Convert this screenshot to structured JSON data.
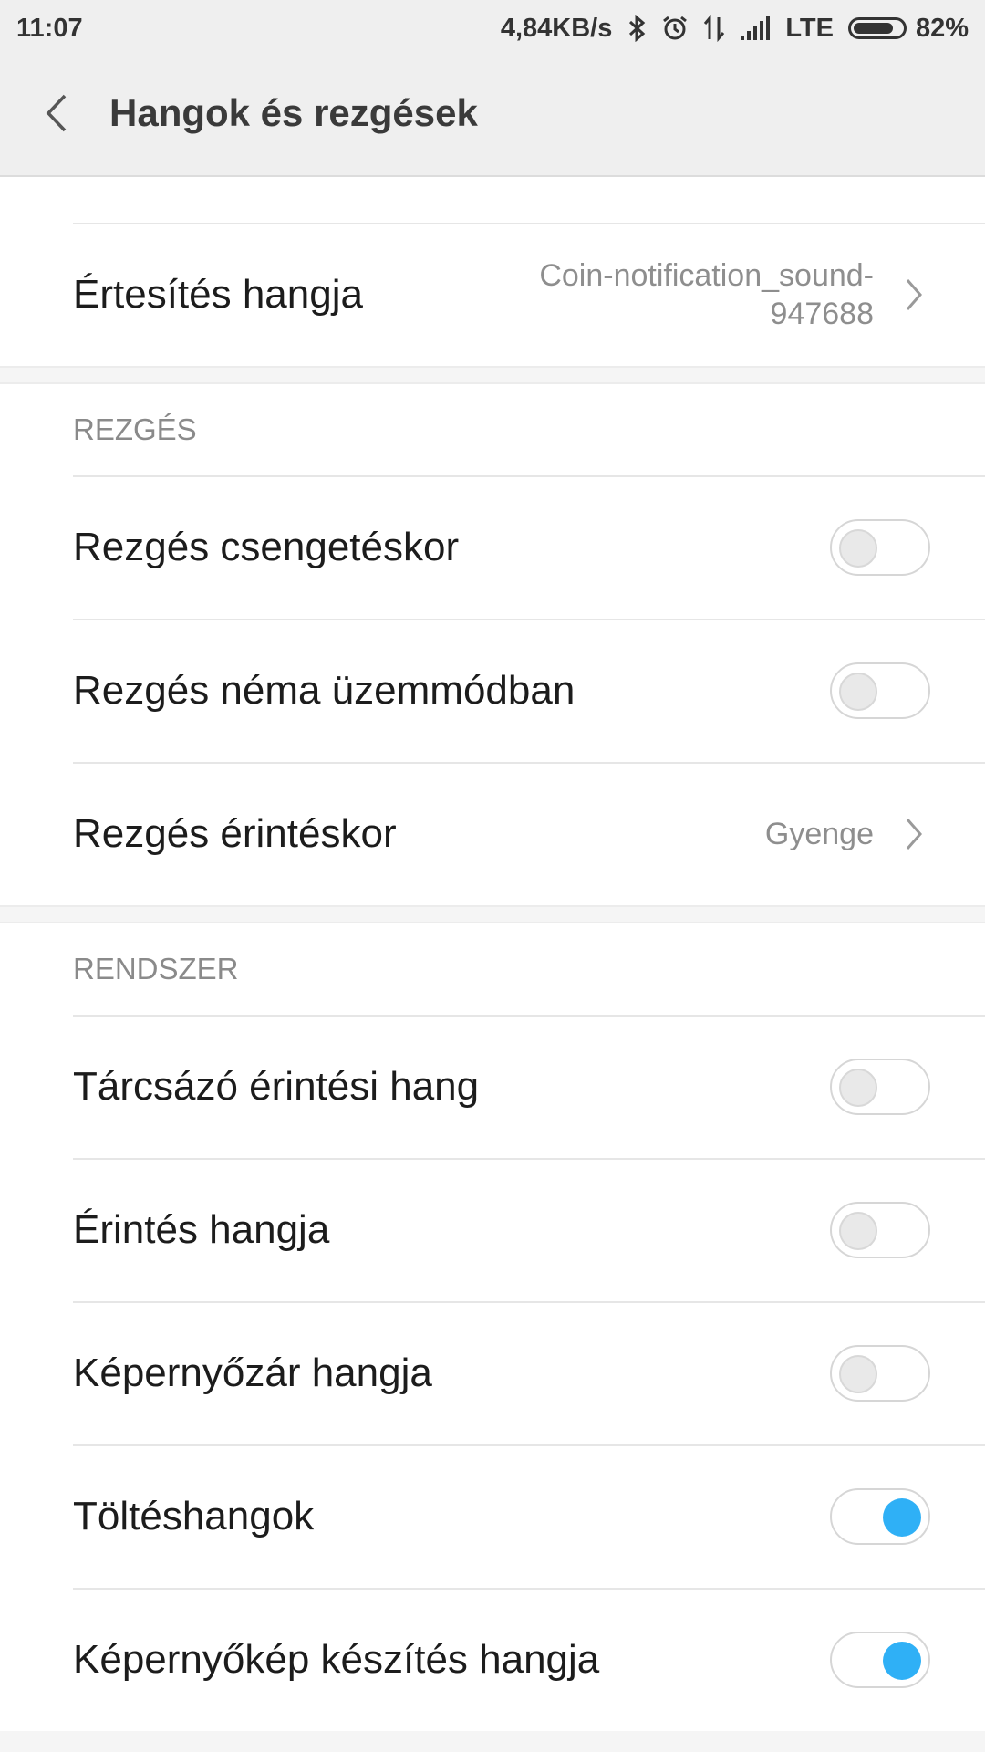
{
  "status_bar": {
    "time": "11:07",
    "net_speed": "4,84KB/s",
    "network": "LTE",
    "battery": "82%",
    "battery_level": 0.82,
    "icons": [
      "bluetooth-icon",
      "alarm-icon",
      "data-transfer-icon",
      "signal-icon"
    ]
  },
  "header": {
    "title": "Hangok és rezgések",
    "back_icon": "chevron-left-icon"
  },
  "notification": {
    "label": "Értesítés hangja",
    "value": "Coin-notification_sound-947688"
  },
  "vibration": {
    "header": "REZGÉS",
    "items": [
      {
        "label": "Rezgés csengetéskor",
        "type": "toggle",
        "on": false
      },
      {
        "label": "Rezgés néma üzemmódban",
        "type": "toggle",
        "on": false
      },
      {
        "label": "Rezgés érintéskor",
        "type": "link",
        "value": "Gyenge"
      }
    ]
  },
  "system": {
    "header": "RENDSZER",
    "items": [
      {
        "label": "Tárcsázó érintési hang",
        "type": "toggle",
        "on": false
      },
      {
        "label": "Érintés hangja",
        "type": "toggle",
        "on": false
      },
      {
        "label": "Képernyőzár hangja",
        "type": "toggle",
        "on": false
      },
      {
        "label": "Töltéshangok",
        "type": "toggle",
        "on": true
      },
      {
        "label": "Képernyőkép készítés hangja",
        "type": "toggle",
        "on": true
      }
    ]
  },
  "colors": {
    "accent": "#2fb0f6",
    "background": "#f5f5f5",
    "header_bg": "#efefef"
  }
}
